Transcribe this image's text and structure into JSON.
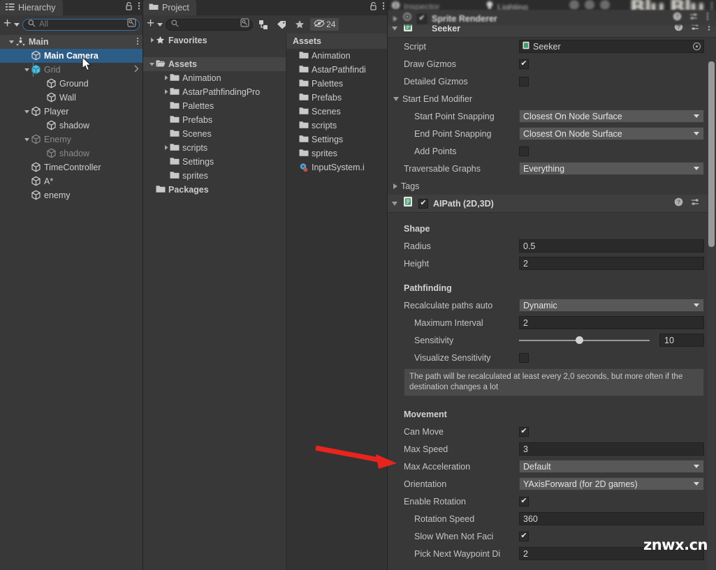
{
  "hierarchy": {
    "tab_label": "Hierarchy",
    "tab_icon": "hierarchy-icon",
    "lock_icon": "lock-icon",
    "menu_icon": "kebab-menu-icon",
    "toolbar": {
      "add_label": "+",
      "search_mode": "All",
      "search_value": "",
      "picker_icon": "object-picker-icon"
    },
    "items": [
      {
        "label": "Main",
        "depth": 1,
        "arrow": "down",
        "icon": "scene-icon",
        "state": "normal",
        "selected": false,
        "kebab": true
      },
      {
        "label": "Main Camera",
        "depth": 2,
        "arrow": "none",
        "icon": "gameobject-icon",
        "state": "normal",
        "selected": true,
        "kebab": false
      },
      {
        "label": "Grid",
        "depth": 2,
        "arrow": "down",
        "icon": "prefab-icon",
        "state": "dim",
        "selected": false,
        "chevron": true
      },
      {
        "label": "Ground",
        "depth": 3,
        "arrow": "none",
        "icon": "gameobject-icon",
        "state": "normal",
        "selected": false
      },
      {
        "label": "Wall",
        "depth": 3,
        "arrow": "none",
        "icon": "gameobject-icon",
        "state": "normal",
        "selected": false
      },
      {
        "label": "Player",
        "depth": 2,
        "arrow": "down",
        "icon": "gameobject-icon",
        "state": "normal",
        "selected": false
      },
      {
        "label": "shadow",
        "depth": 3,
        "arrow": "none",
        "icon": "gameobject-icon",
        "state": "normal",
        "selected": false
      },
      {
        "label": "Enemy",
        "depth": 2,
        "arrow": "down",
        "icon": "gameobject-icon",
        "state": "dim",
        "selected": false
      },
      {
        "label": "shadow",
        "depth": 3,
        "arrow": "none",
        "icon": "gameobject-icon",
        "state": "dim",
        "selected": false
      },
      {
        "label": "TimeController",
        "depth": 2,
        "arrow": "none",
        "icon": "gameobject-icon",
        "state": "normal",
        "selected": false
      },
      {
        "label": "A*",
        "depth": 2,
        "arrow": "none",
        "icon": "gameobject-icon",
        "state": "normal",
        "selected": false
      },
      {
        "label": "enemy",
        "depth": 2,
        "arrow": "none",
        "icon": "gameobject-icon",
        "state": "normal",
        "selected": false
      }
    ]
  },
  "project": {
    "tab_label": "Project",
    "tab_icon": "folder-icon",
    "lock_icon": "lock-icon",
    "menu_icon": "kebab-menu-icon",
    "toolbar": {
      "add_label": "+",
      "search_placeholder": "",
      "search_value": "",
      "picker_icon": "object-picker-icon",
      "filter_type_icon": "filter-by-type-icon",
      "filter_label_icon": "filter-by-label-icon",
      "favorites_icon": "star-icon",
      "hidden_icon": "eye-slash-icon",
      "hidden_count": "24"
    },
    "tree": [
      {
        "label": "Favorites",
        "depth": 0,
        "arrow": "right",
        "icon": "star-icon",
        "selected": false
      },
      {
        "label": "",
        "depth": 0,
        "arrow": "none",
        "icon": "spacer",
        "selected": false,
        "spacer": true
      },
      {
        "label": "Assets",
        "depth": 0,
        "arrow": "down",
        "icon": "folder-open-icon",
        "selected": true
      },
      {
        "label": "Animation",
        "depth": 1,
        "arrow": "right",
        "icon": "folder-icon",
        "selected": false
      },
      {
        "label": "AstarPathfindingPro",
        "depth": 1,
        "arrow": "right",
        "icon": "folder-icon",
        "selected": false
      },
      {
        "label": "Palettes",
        "depth": 1,
        "arrow": "none",
        "icon": "folder-icon",
        "selected": false
      },
      {
        "label": "Prefabs",
        "depth": 1,
        "arrow": "none",
        "icon": "folder-icon",
        "selected": false
      },
      {
        "label": "Scenes",
        "depth": 1,
        "arrow": "none",
        "icon": "folder-icon",
        "selected": false
      },
      {
        "label": "scripts",
        "depth": 1,
        "arrow": "right",
        "icon": "folder-icon",
        "selected": false
      },
      {
        "label": "Settings",
        "depth": 1,
        "arrow": "none",
        "icon": "folder-icon",
        "selected": false
      },
      {
        "label": "sprites",
        "depth": 1,
        "arrow": "none",
        "icon": "folder-icon",
        "selected": false
      },
      {
        "label": "Packages",
        "depth": 0,
        "arrow": "none",
        "icon": "folder-icon",
        "selected": false
      }
    ],
    "assets_column_header": "Assets",
    "assets": [
      {
        "label": "Animation",
        "icon": "folder-icon"
      },
      {
        "label": "AstarPathfindi",
        "icon": "folder-icon"
      },
      {
        "label": "Palettes",
        "icon": "folder-icon"
      },
      {
        "label": "Prefabs",
        "icon": "folder-icon"
      },
      {
        "label": "Scenes",
        "icon": "folder-icon"
      },
      {
        "label": "scripts",
        "icon": "folder-icon"
      },
      {
        "label": "Settings",
        "icon": "folder-icon"
      },
      {
        "label": "sprites",
        "icon": "folder-icon"
      },
      {
        "label": "InputSystem.i",
        "icon": "inputactions-asset-icon"
      }
    ]
  },
  "inspector": {
    "tab_label": "Inspector",
    "tab_icon": "info-icon",
    "tab2_label": "Lighting",
    "tab2_icon": "light-bulb-icon",
    "partial_component": "Sprite Renderer",
    "components": [
      {
        "name": "Seeker",
        "icon": "script-icon",
        "has_enable_toggle": false,
        "help_icon": "help-icon",
        "preset_icon": "preset-icon",
        "menu_icon": "kebab-menu-icon",
        "fields": [
          {
            "type": "object",
            "label": "Script",
            "value": "Seeker",
            "indent": 1
          },
          {
            "type": "checkbox",
            "label": "Draw Gizmos",
            "value": true,
            "indent": 1
          },
          {
            "type": "checkbox",
            "label": "Detailed Gizmos",
            "value": false,
            "indent": 1
          },
          {
            "type": "foldout",
            "label": "Start End Modifier",
            "open": true,
            "indent": 1
          },
          {
            "type": "dropdown",
            "label": "Start Point Snapping",
            "value": "Closest On Node Surface",
            "indent": 2
          },
          {
            "type": "dropdown",
            "label": "End Point Snapping",
            "value": "Closest On Node Surface",
            "indent": 2
          },
          {
            "type": "checkbox",
            "label": "Add Points",
            "value": false,
            "indent": 2
          },
          {
            "type": "dropdown",
            "label": "Traversable Graphs",
            "value": "Everything",
            "indent": 1
          },
          {
            "type": "foldout",
            "label": "Tags",
            "open": false,
            "indent": 1
          }
        ]
      },
      {
        "name": "AIPath (2D,3D)",
        "icon": "script-icon",
        "has_enable_toggle": true,
        "enabled": true,
        "help_icon": "help-icon",
        "preset_icon": "preset-icon",
        "menu_icon": "kebab-menu-icon",
        "fields": [
          {
            "type": "spacer"
          },
          {
            "type": "section",
            "label": "Shape"
          },
          {
            "type": "text",
            "label": "Radius",
            "value": "0.5",
            "indent": 1
          },
          {
            "type": "text",
            "label": "Height",
            "value": "2",
            "indent": 1
          },
          {
            "type": "spacer"
          },
          {
            "type": "section",
            "label": "Pathfinding"
          },
          {
            "type": "dropdown",
            "label": "Recalculate paths auto",
            "value": "Dynamic",
            "indent": 1
          },
          {
            "type": "text",
            "label": "Maximum Interval",
            "value": "2",
            "indent": 2
          },
          {
            "type": "slider",
            "label": "Sensitivity",
            "value": "10",
            "fraction": 0.44,
            "indent": 2
          },
          {
            "type": "checkbox",
            "label": "Visualize Sensitivity",
            "value": false,
            "indent": 2
          },
          {
            "type": "helpbox",
            "label": "The path will be recalculated at least every 2,0 seconds, but more often if the destination changes a lot"
          },
          {
            "type": "spacer"
          },
          {
            "type": "section",
            "label": "Movement"
          },
          {
            "type": "checkbox",
            "label": "Can Move",
            "value": true,
            "indent": 1
          },
          {
            "type": "text",
            "label": "Max Speed",
            "value": "3",
            "indent": 1,
            "highlighted": true
          },
          {
            "type": "dropdown",
            "label": "Max Acceleration",
            "value": "Default",
            "indent": 1
          },
          {
            "type": "dropdown",
            "label": "Orientation",
            "value": "YAxisForward (for 2D games)",
            "indent": 1
          },
          {
            "type": "checkbox",
            "label": "Enable Rotation",
            "value": true,
            "indent": 1
          },
          {
            "type": "text",
            "label": "Rotation Speed",
            "value": "360",
            "indent": 2
          },
          {
            "type": "checkbox",
            "label": "Slow When Not Faci",
            "value": true,
            "indent": 2
          },
          {
            "type": "text",
            "label": "Pick Next Waypoint Di",
            "value": "2",
            "indent": 2
          }
        ]
      }
    ]
  },
  "annotation": {
    "arrow_color": "#e8241f",
    "arrow_target": "Max Speed"
  },
  "watermark": {
    "text": "znwx.cn"
  },
  "colors": {
    "panel_bg": "#383838",
    "tab_bg_active": "#3d3d3d",
    "tab_bg_inactive": "#2d2d2d",
    "selection_blue": "#2c5d87",
    "field_bg": "#2a2a2a",
    "dropdown_bg": "#585858",
    "text": "#c4c4c4",
    "accent_red": "#e8241f"
  }
}
